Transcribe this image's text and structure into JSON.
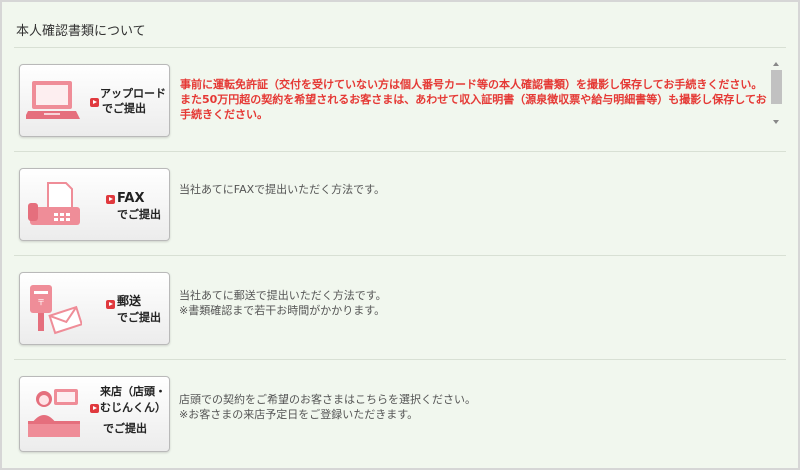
{
  "section": {
    "title": "本人確認書類について"
  },
  "rows": [
    {
      "button": {
        "line1": "アップロード",
        "line2": "でご提出"
      },
      "desc": "事前に運転免許証（交付を受けていない方は個人番号カード等の本人確認書類）を撮影し保存してお手続きください。\nまた50万円超の契約を希望されるお客さまは、あわせて収入証明書（源泉徴収票や給与明細書等）も撮影し保存してお手続きください。"
    },
    {
      "button": {
        "line1": "FAX",
        "line2": "でご提出"
      },
      "desc": "当社あてにFAXで提出いただく方法です。"
    },
    {
      "button": {
        "line1": "郵送",
        "line2": "でご提出"
      },
      "desc": "当社あてに郵送で提出いただく方法です。\n※書類確認まで若干お時間がかかります。"
    },
    {
      "button": {
        "line1": "来店（店頭・",
        "line2": "むじんくん）",
        "line3": "でご提出"
      },
      "desc": "店頭での契約をご希望のお客さまはこちらを選択ください。\n※お客さまの来店予定日をご登録いただきます。"
    }
  ],
  "colors": {
    "accent": "#e0393e",
    "illustration": "#ef8d98",
    "background": "#f1f7ee"
  },
  "icons": [
    "laptop-icon",
    "fax-machine-icon",
    "postbox-envelope-icon",
    "store-staff-icon"
  ]
}
